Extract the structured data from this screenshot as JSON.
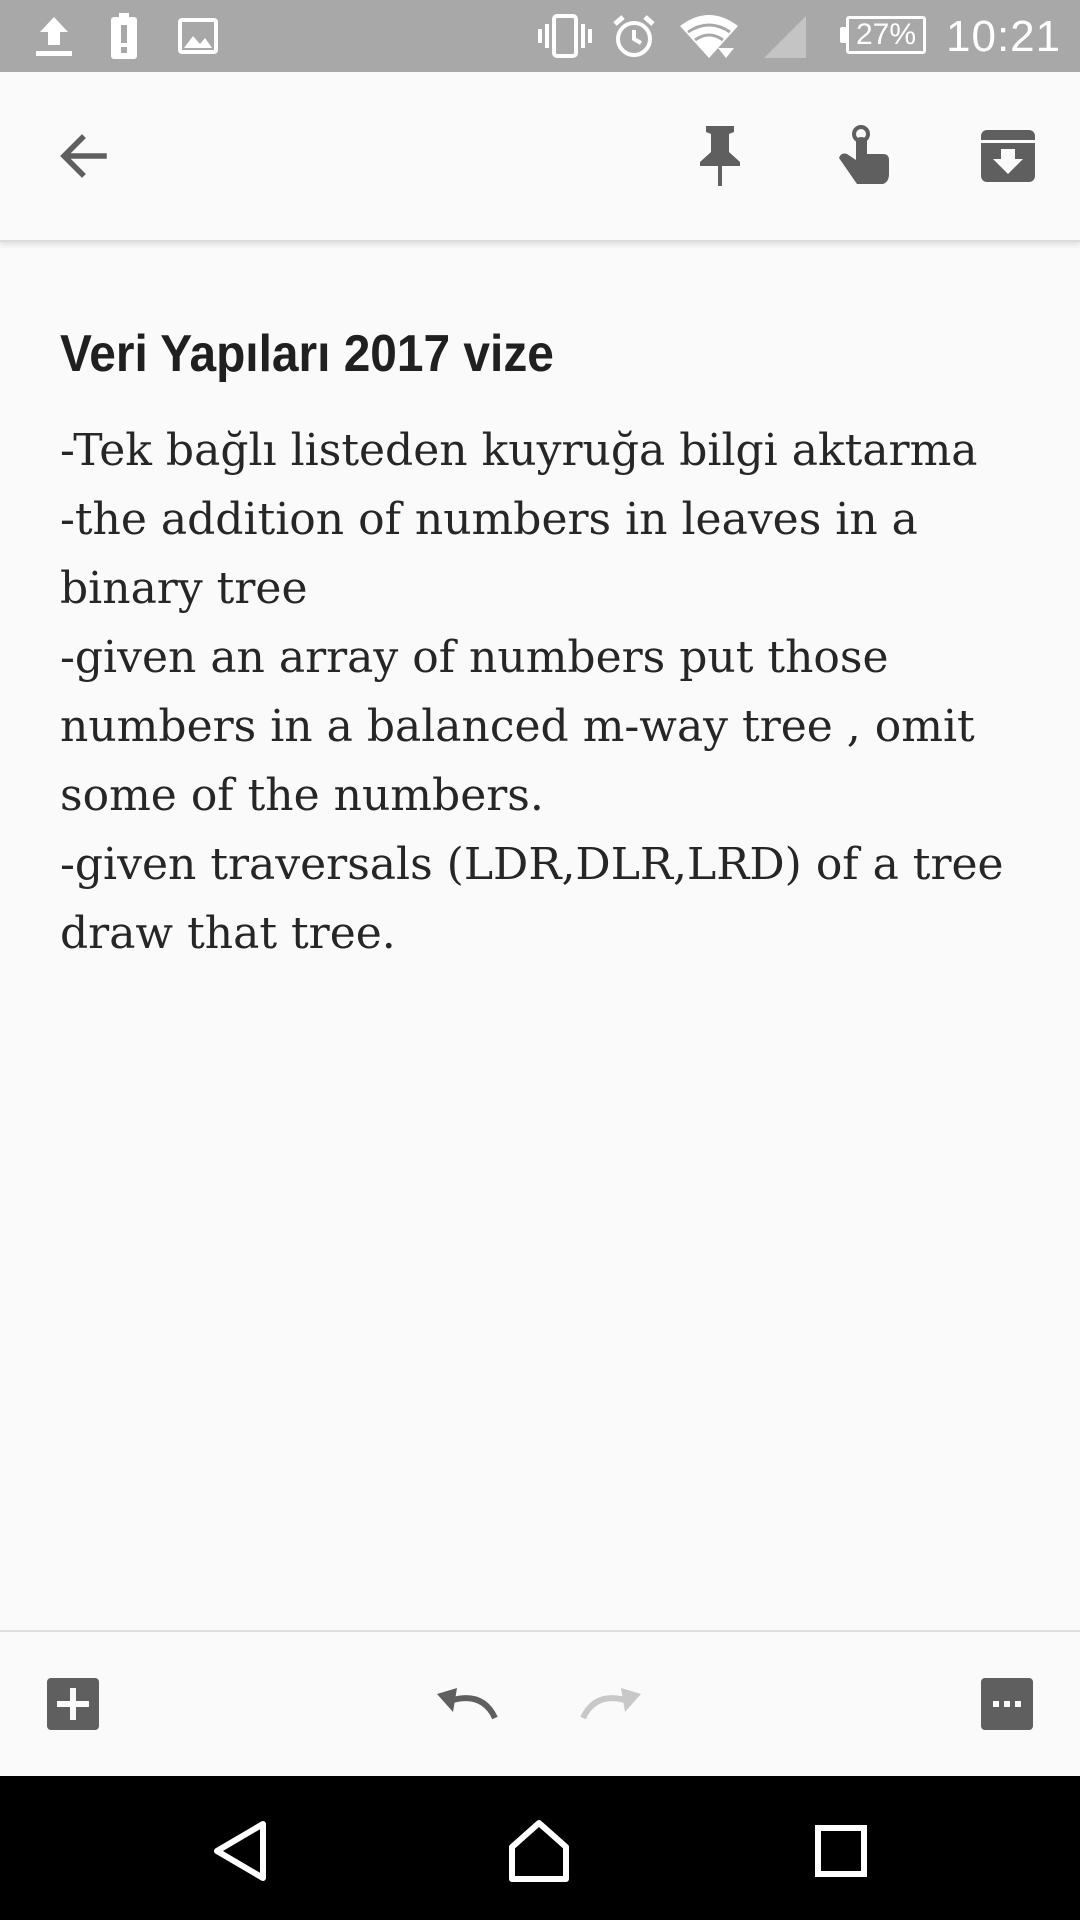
{
  "status_bar": {
    "battery_percent": "27%",
    "time": "10:21",
    "icons": [
      "upload-icon",
      "battery-alert-icon",
      "image-icon",
      "vibrate-icon",
      "alarm-icon",
      "wifi-icon",
      "cell-signal-icon"
    ]
  },
  "toolbar": {
    "icons": [
      "back-arrow-icon",
      "pin-icon",
      "reminder-icon",
      "archive-icon"
    ]
  },
  "note": {
    "title": "Veri Yapıları 2017 vize",
    "body_lines": [
      "-Tek bağlı listeden kuyruğa bilgi aktarma",
      "-the addition of numbers in leaves in a",
      "binary tree",
      "-given an array of numbers put those",
      "numbers in a balanced m-way tree , omit",
      "some of the numbers.",
      "-given traversals (LDR,DLR,LRD) of a tree",
      "draw that tree."
    ]
  },
  "bottom_bar": {
    "icons": [
      "add-box-icon",
      "undo-icon",
      "redo-icon",
      "more-options-icon"
    ]
  },
  "nav_bar": {
    "icons": [
      "nav-back-icon",
      "nav-home-icon",
      "nav-recents-icon"
    ]
  },
  "colors": {
    "status_bar": "#a8a8a8",
    "background": "#fafafa",
    "icon": "#5f5f5f",
    "icon_disabled": "#c8c8c8",
    "nav_bar": "#000000"
  }
}
